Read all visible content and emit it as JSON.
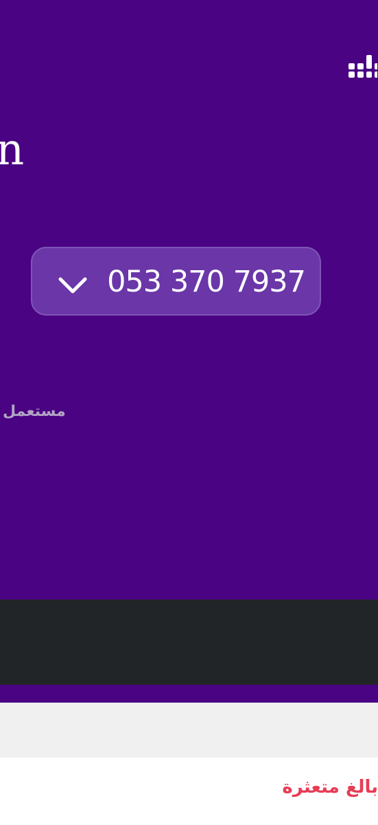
{
  "header": {
    "menu_icon": "grid-dots-icon",
    "title_fragment": "n"
  },
  "number_selector": {
    "value": "053 370 7937",
    "chevron_icon": "chevron-down-icon"
  },
  "status": {
    "label": "مستعمل"
  },
  "content": {
    "heading": "بالغ متعثرة"
  },
  "colors": {
    "hero_background": "#4a0383",
    "selector_background": "#6a36a8",
    "dark_bar": "#222528",
    "grey_band": "#f0f0f1",
    "heading_red": "#e83c55"
  }
}
